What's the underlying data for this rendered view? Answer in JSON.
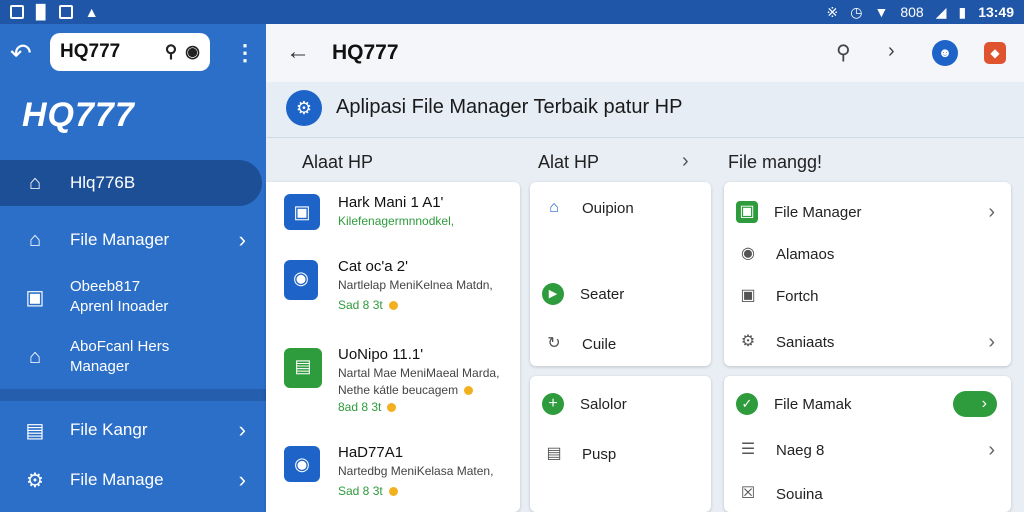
{
  "status_bar": {
    "battery": "808",
    "time": "13:49"
  },
  "sidebar": {
    "search_value": "HQ777",
    "logo": "HQ777",
    "items": [
      {
        "label": "Hlq776B",
        "icon": "home-outline-icon",
        "active": true
      },
      {
        "label": "File Manager",
        "icon": "home-icon",
        "chevron": true
      },
      {
        "label": "Obeeb817\nAprenl Inoader",
        "icon": "briefcase-icon"
      },
      {
        "label": "AboFcanl Hers\nManager",
        "icon": "house-icon"
      },
      {
        "label": "File Kangr",
        "icon": "calendar-icon",
        "chevron": true
      },
      {
        "label": "File Manage",
        "icon": "gear-icon",
        "chevron": true
      }
    ]
  },
  "topbar": {
    "title": "HQ777"
  },
  "banner": {
    "text": "Aplipasi File Manager Terbaik patur HP"
  },
  "columns": {
    "col1_header": "Alaat HP",
    "col2_header": "Alat HP",
    "col3_header": "File mangg!"
  },
  "list": [
    {
      "title": "Hark Mani 1 A1'",
      "sub1": "Kilefenagermnnodkel,",
      "sub1_green": true
    },
    {
      "title": "Cat oc'a 2'",
      "sub1": "Nartlelap MeniKelnea Matdn,",
      "meta": "Sad 8 3t"
    },
    {
      "title": "UoNipo 11.1'",
      "sub1": "Nartal Mae MeniMaeal Marda,",
      "sub2": "Nethe kátle beucagem",
      "meta": "8ad 8 3t"
    },
    {
      "title": "HaD77A1",
      "sub1": "Nartedbg MeniKelasa Maten,",
      "meta": "Sad 8 3t"
    }
  ],
  "col2_card1": [
    {
      "label": "Ouipion",
      "icon": "home-icon"
    },
    {
      "label": "Seater",
      "icon": "play-icon"
    },
    {
      "label": "Cuile",
      "icon": "refresh-icon"
    }
  ],
  "col2_card2": [
    {
      "label": "Salolor",
      "icon": "plus-circle-icon"
    },
    {
      "label": "Pusp",
      "icon": "document-icon"
    }
  ],
  "col3_card1": [
    {
      "label": "File Manager",
      "icon": "folder-icon",
      "chevron": true
    },
    {
      "label": "Alamaos",
      "icon": "location-icon"
    },
    {
      "label": "Fortch",
      "icon": "lock-icon"
    },
    {
      "label": "Saniaats",
      "icon": "settings-icon",
      "chevron": true
    }
  ],
  "col3_card2": [
    {
      "label": "File Mamak",
      "icon": "check-shield-icon",
      "toggle": true
    },
    {
      "label": "Naeg 8",
      "icon": "list-icon",
      "chevron": true
    },
    {
      "label": "Souina",
      "icon": "close-box-icon"
    }
  ],
  "colors": {
    "primary_blue": "#2c6fc9",
    "status_blue": "#1f56a8",
    "accent_green": "#2e9b3c",
    "dot_yellow": "#f2b01e"
  }
}
